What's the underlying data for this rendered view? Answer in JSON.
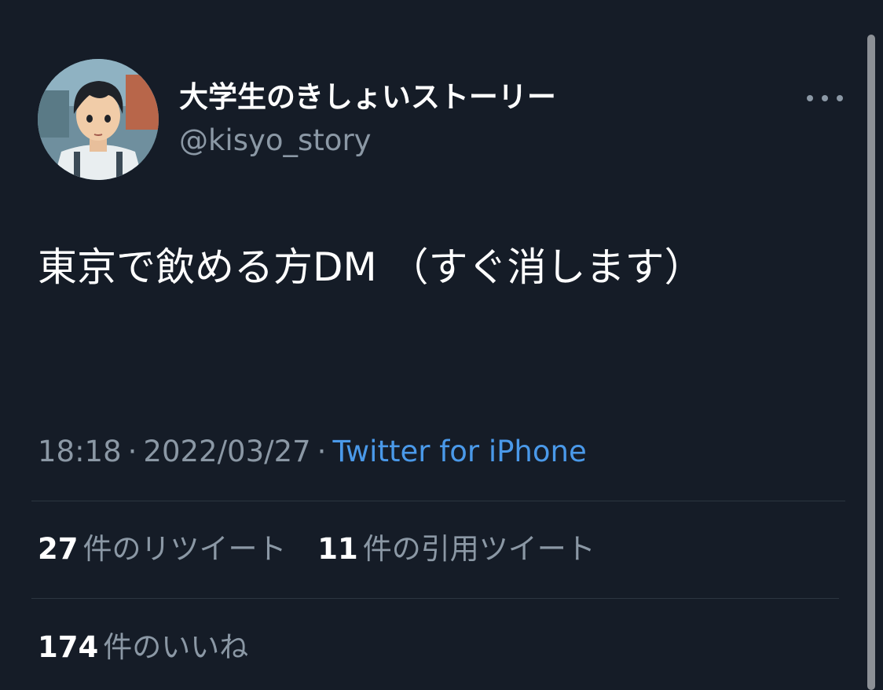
{
  "user": {
    "display_name": "大学生のきしょいストーリー",
    "handle": "@kisyo_story",
    "avatar_icon": "anime-boy-avatar"
  },
  "menu": {
    "more_icon": "more-horizontal-icon"
  },
  "tweet": {
    "text": "東京で飲める方DM （すぐ消します）",
    "time": "18:18",
    "separator": "·",
    "date": "2022/03/27",
    "source": "Twitter for iPhone"
  },
  "stats": {
    "retweets": {
      "count": "27",
      "label": "件のリツイート"
    },
    "quotes": {
      "count": "11",
      "label": "件の引用ツイート"
    },
    "likes": {
      "count": "174",
      "label": "件のいいね"
    }
  },
  "colors": {
    "background": "#151c27",
    "primary_text": "#ffffff",
    "secondary_text": "#8b98a5",
    "link": "#4a99e9",
    "divider": "#2c3640"
  }
}
